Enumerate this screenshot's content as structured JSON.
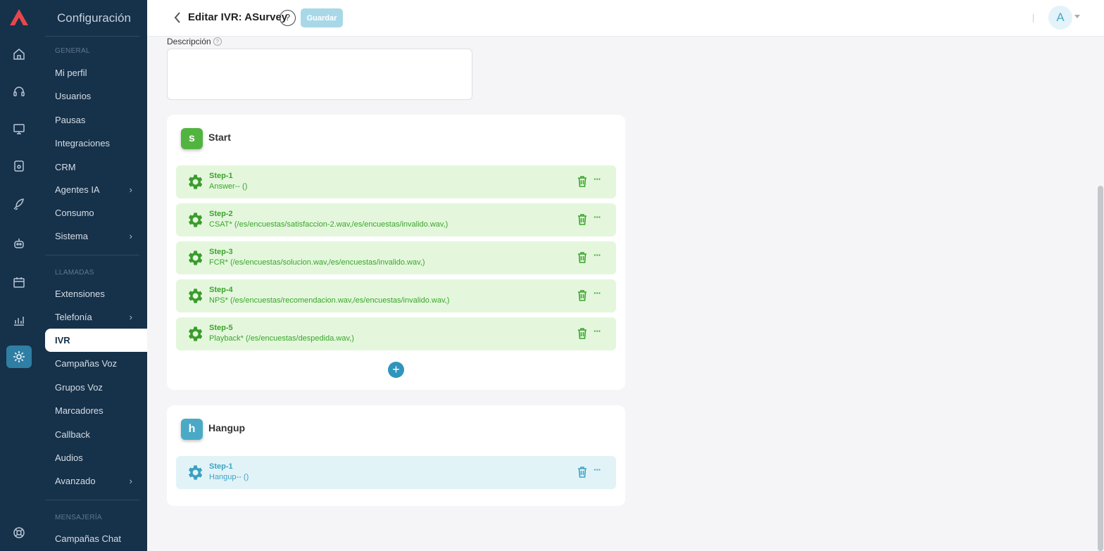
{
  "sidebar": {
    "title": "Configuración",
    "sections": {
      "general": "GENERAL",
      "llamadas": "LLAMADAS",
      "mensajeria": "MENSAJERÍA"
    },
    "items": [
      {
        "label": "Mi perfil"
      },
      {
        "label": "Usuarios"
      },
      {
        "label": "Pausas"
      },
      {
        "label": "Integraciones"
      },
      {
        "label": "CRM"
      },
      {
        "label": "Agentes IA"
      },
      {
        "label": "Consumo"
      },
      {
        "label": "Sistema"
      },
      {
        "label": "Extensiones"
      },
      {
        "label": "Telefonía"
      },
      {
        "label": "IVR"
      },
      {
        "label": "Campañas Voz"
      },
      {
        "label": "Grupos Voz"
      },
      {
        "label": "Marcadores"
      },
      {
        "label": "Callback"
      },
      {
        "label": "Audios"
      },
      {
        "label": "Avanzado"
      },
      {
        "label": "Campañas Chat"
      }
    ],
    "chevron": "›"
  },
  "header": {
    "title": "Editar IVR: ASurvey",
    "help": "?",
    "save_label": "Guardar",
    "avatar": "A"
  },
  "form": {
    "description_label": "Descripción",
    "description_help": "?"
  },
  "blocks": {
    "start": {
      "badge": "s",
      "title": "Start",
      "steps": [
        {
          "name": "Step-1",
          "desc": "Answer-- ()"
        },
        {
          "name": "Step-2",
          "desc": "CSAT* (/es/encuestas/satisfaccion-2.wav,/es/encuestas/invalido.wav,)"
        },
        {
          "name": "Step-3",
          "desc": "FCR* (/es/encuestas/solucion.wav,/es/encuestas/invalido.wav,)"
        },
        {
          "name": "Step-4",
          "desc": "NPS* (/es/encuestas/recomendacion.wav,/es/encuestas/invalido.wav,)"
        },
        {
          "name": "Step-5",
          "desc": "Playback* (/es/encuestas/despedida.wav,)"
        }
      ],
      "add": "+"
    },
    "hangup": {
      "badge": "h",
      "title": "Hangup",
      "steps": [
        {
          "name": "Step-1",
          "desc": "Hangup-- ()"
        }
      ]
    }
  },
  "more_glyph": "···",
  "colors": {
    "sidebar_bg": "#16314a",
    "accent": "#2f7fa5",
    "start_green": "#52b440",
    "hangup_blue": "#4aaac6",
    "save_disabled": "#a8d8e8"
  }
}
